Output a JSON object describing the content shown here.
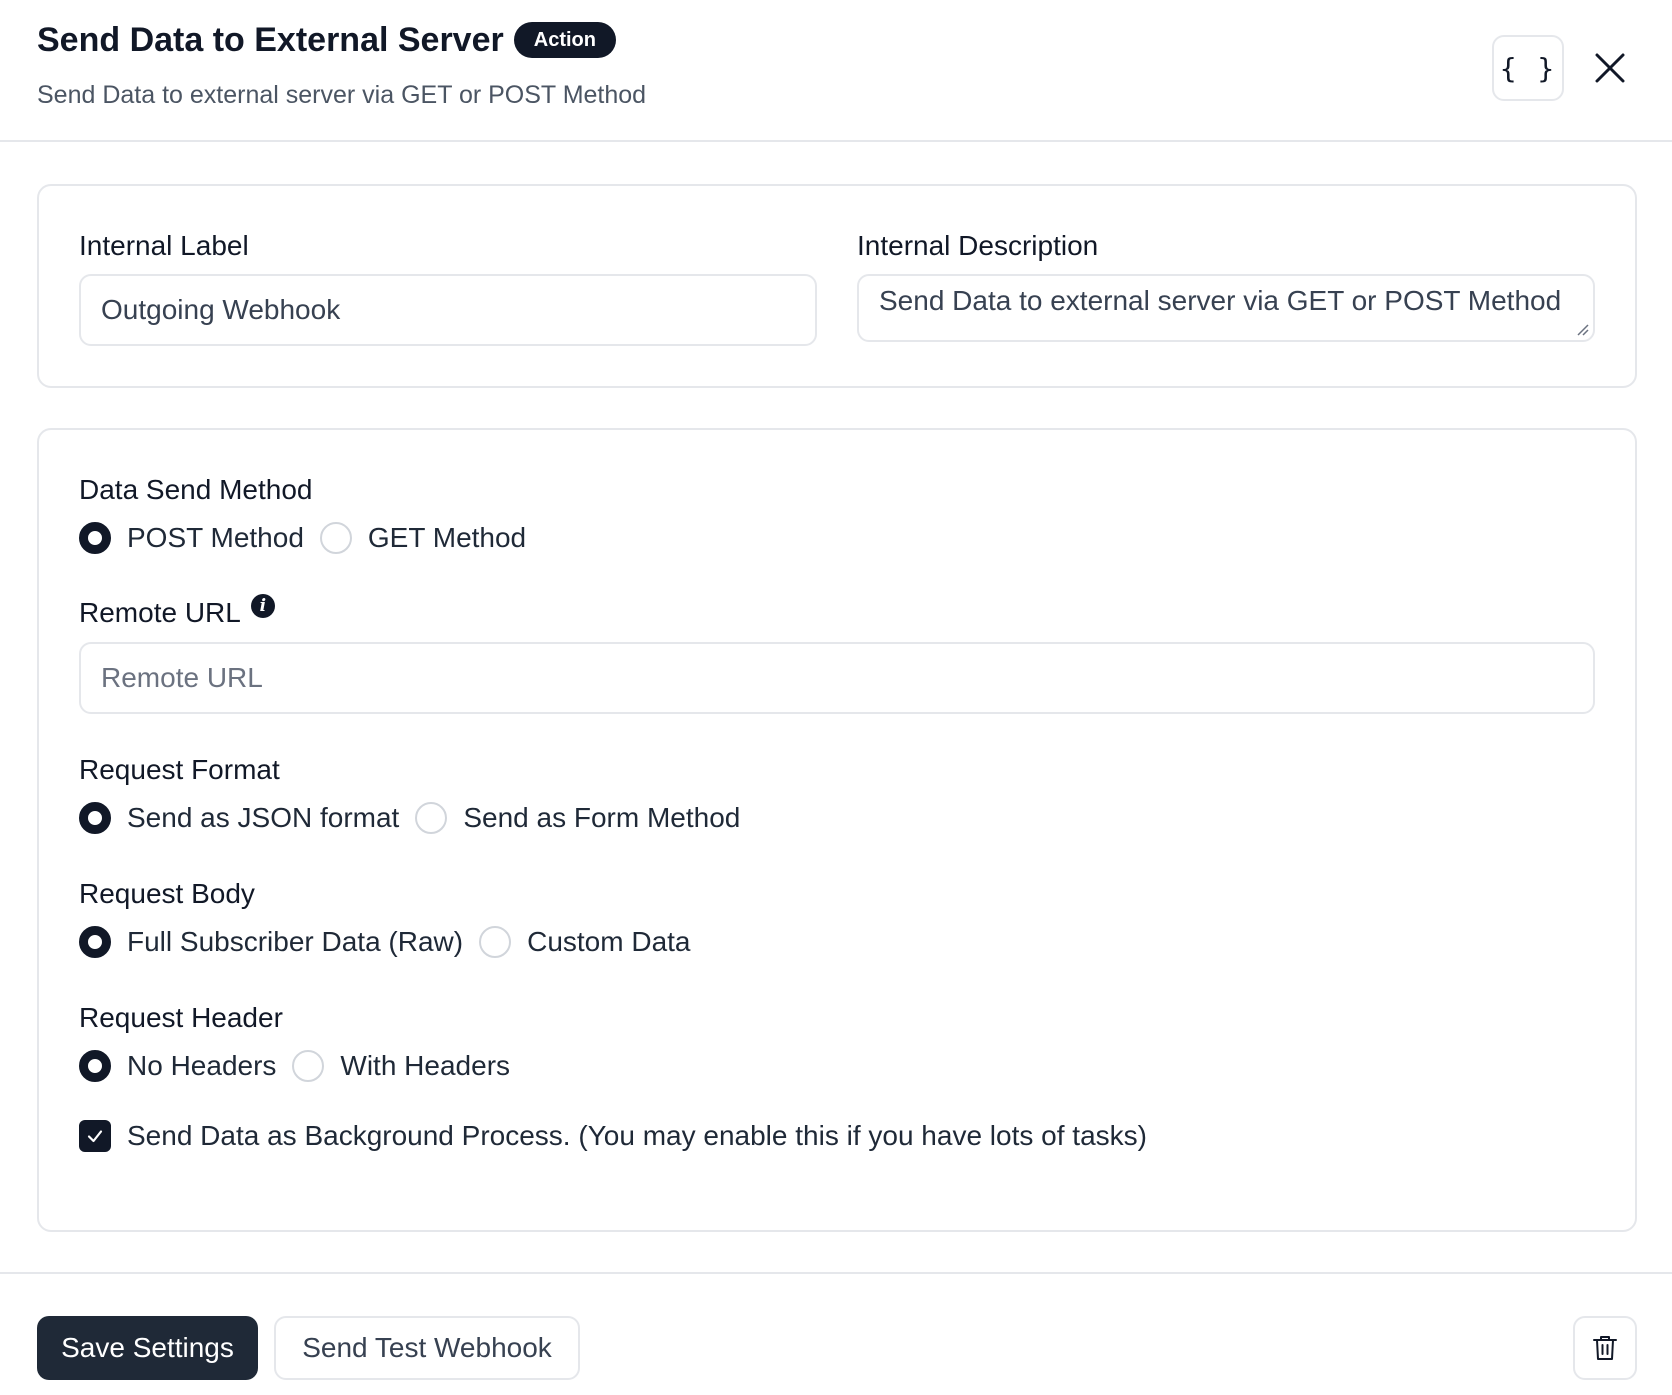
{
  "header": {
    "title": "Send Data to External Server",
    "badge": "Action",
    "subtitle": "Send Data to external server via GET or POST Method",
    "braces_icon": "{ }"
  },
  "general": {
    "internal_label": {
      "label": "Internal Label",
      "value": "Outgoing Webhook"
    },
    "internal_description": {
      "label": "Internal Description",
      "value": "Send Data to external server via GET or POST Method"
    }
  },
  "settings": {
    "data_send_method": {
      "label": "Data Send Method",
      "options": [
        "POST Method",
        "GET Method"
      ],
      "selected": "POST Method"
    },
    "remote_url": {
      "label": "Remote URL",
      "placeholder": "Remote URL",
      "value": "",
      "info_icon": "info-icon"
    },
    "request_format": {
      "label": "Request Format",
      "options": [
        "Send as JSON format",
        "Send as Form Method"
      ],
      "selected": "Send as JSON format"
    },
    "request_body": {
      "label": "Request Body",
      "options": [
        "Full Subscriber Data (Raw)",
        "Custom Data"
      ],
      "selected": "Full Subscriber Data (Raw)"
    },
    "request_header": {
      "label": "Request Header",
      "options": [
        "No Headers",
        "With Headers"
      ],
      "selected": "No Headers"
    },
    "background_process": {
      "label": "Send Data as Background Process. (You may enable this if you have lots of tasks)",
      "checked": true
    }
  },
  "footer": {
    "save_label": "Save Settings",
    "test_label": "Send Test Webhook",
    "delete_icon": "trash-icon"
  },
  "colors": {
    "primary": "#1f2937",
    "border": "#e5e7eb",
    "text": "#111827",
    "muted": "#4b5563"
  }
}
